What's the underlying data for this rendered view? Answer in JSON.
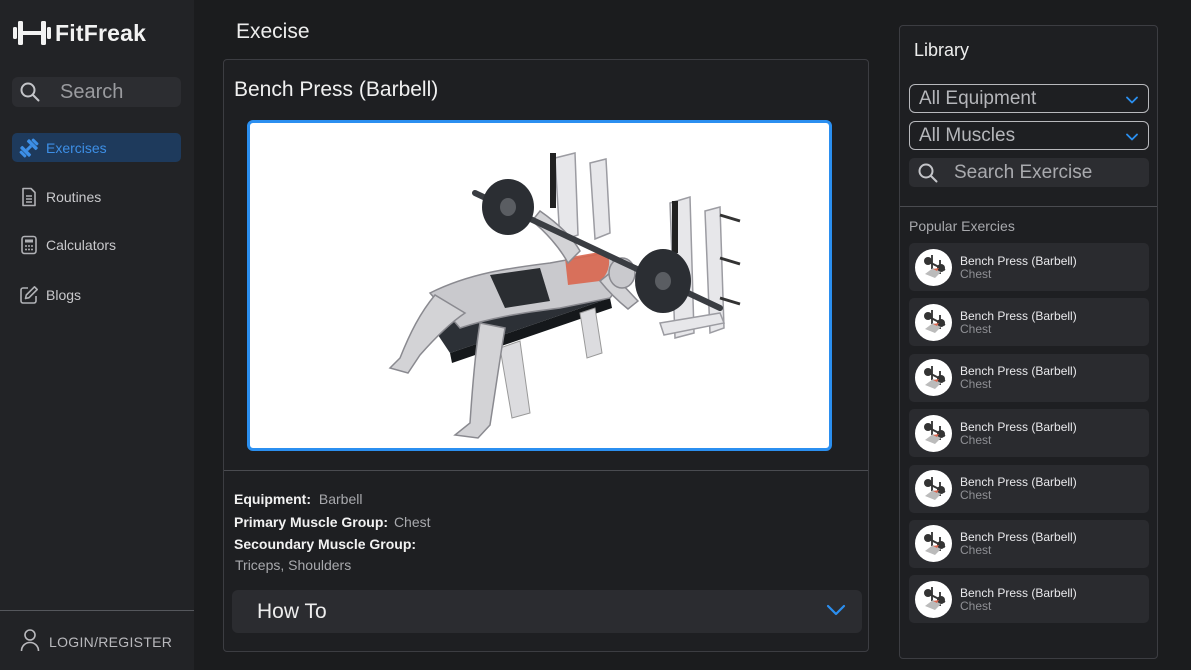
{
  "app": {
    "name": "FitFreak"
  },
  "sidebar": {
    "search_placeholder": "Search",
    "items": [
      {
        "label": "Exercises",
        "icon": "dumbbell-icon",
        "active": true
      },
      {
        "label": "Routines",
        "icon": "document-icon",
        "active": false
      },
      {
        "label": "Calculators",
        "icon": "calculator-icon",
        "active": false
      },
      {
        "label": "Blogs",
        "icon": "edit-icon",
        "active": false
      }
    ],
    "login_label": "LOGIN/REGISTER"
  },
  "main": {
    "page_title": "Execise",
    "exercise": {
      "name": "Bench Press (Barbell)",
      "equipment_label": "Equipment:",
      "equipment_value": "Barbell",
      "primary_label": "Primary Muscle Group:",
      "primary_value": "Chest",
      "secondary_label": "Secoundary Muscle Group:",
      "secondary_value": "Triceps, Shoulders",
      "howto_label": "How To"
    }
  },
  "library": {
    "title": "Library",
    "equipment_filter": "All Equipment",
    "muscle_filter": "All Muscles",
    "search_placeholder": "Search Exercise",
    "popular_title": "Popular Exercies",
    "popular": [
      {
        "name": "Bench Press (Barbell)",
        "group": "Chest"
      },
      {
        "name": "Bench Press (Barbell)",
        "group": "Chest"
      },
      {
        "name": "Bench Press (Barbell)",
        "group": "Chest"
      },
      {
        "name": "Bench Press (Barbell)",
        "group": "Chest"
      },
      {
        "name": "Bench Press (Barbell)",
        "group": "Chest"
      },
      {
        "name": "Bench Press (Barbell)",
        "group": "Chest"
      },
      {
        "name": "Bench Press (Barbell)",
        "group": "Chest"
      }
    ]
  },
  "colors": {
    "accent": "#2b8ff0",
    "background": "#1b1c1e",
    "panel": "#222326"
  }
}
